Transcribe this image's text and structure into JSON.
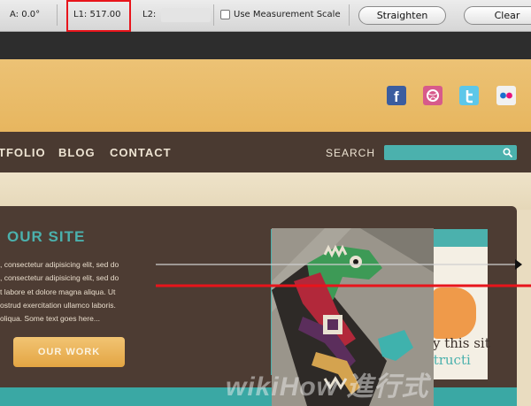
{
  "toolbar": {
    "angle": "A: 0.0°",
    "length1": "L1: 517.00",
    "length2": "L2:",
    "use_measurement_scale": "Use Measurement Scale",
    "straighten": "Straighten",
    "clear": "Clear",
    "highlight_color": "#e8141b"
  },
  "site": {
    "nav": {
      "items": [
        "TFOLIO",
        "BLOG",
        "CONTACT"
      ],
      "search_label": "SEARCH"
    },
    "social_icons": [
      "facebook-icon",
      "dribbble-icon",
      "twitter-icon",
      "flickr-icon"
    ],
    "hero": {
      "title": "OUR SITE",
      "paragraph_lines": [
        ", consectetur adipisicing elit, sed do",
        ", consectetur adipisicing elit, sed do",
        "t labore et dolore magna aliqua. Ut",
        "ostrud exercitation ullamco laboris.",
        "oliqua.  Some  text  goes    here..."
      ],
      "button": "OUR WORK",
      "slide_text_1": "y this sit",
      "slide_text_2": "structi"
    },
    "colors": {
      "header": "#e7b65f",
      "nav": "#4a3a31",
      "accent": "#4bb1ad",
      "measure_line": "#e8141b"
    }
  },
  "watermark": "wikiHow 進行式"
}
